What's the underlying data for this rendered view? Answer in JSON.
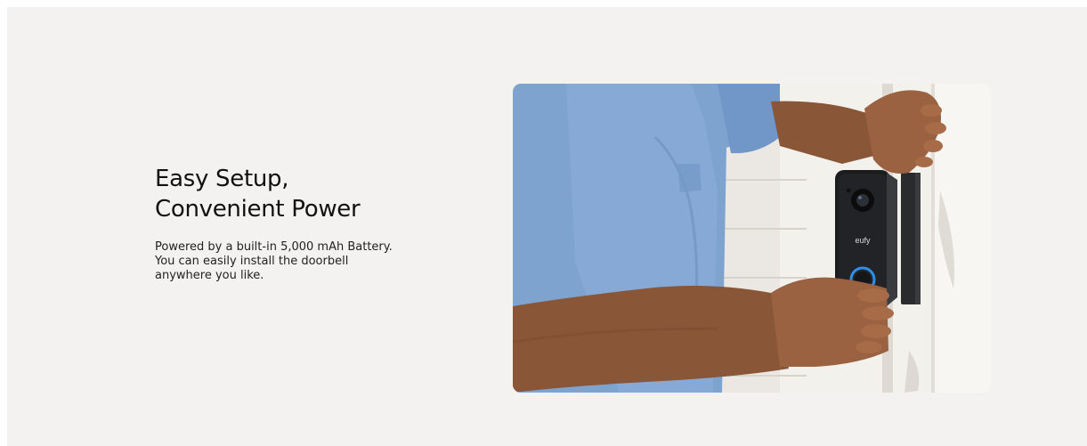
{
  "feature": {
    "headline_line1": "Easy Setup,",
    "headline_line2": "Convenient Power",
    "body_line1": "Powered by a built-in 5,000 mAh Battery.",
    "body_line2": "You can easily install the doorbell",
    "body_line3": "anywhere you like."
  },
  "photo": {
    "device_brand": "eufy"
  },
  "colors": {
    "section_background": "#f4f2f0",
    "text": "#111111",
    "shirt": "#7fa3cf",
    "doorbell_body": "#1b1c1e",
    "button_ring": "#2f8fe6",
    "skin": "#8a5638"
  }
}
